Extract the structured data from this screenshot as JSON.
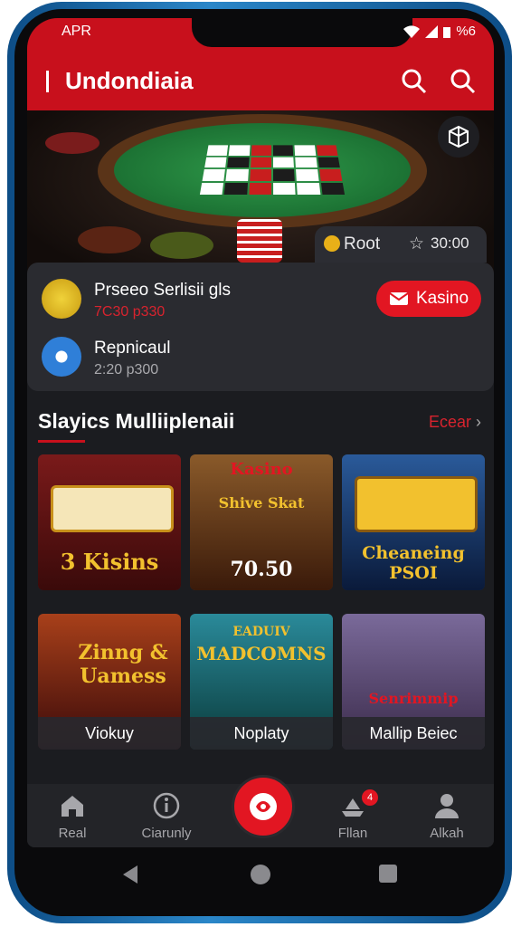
{
  "status": {
    "carrier": "APR",
    "battery": "%6"
  },
  "app": {
    "title": "Undondiaia"
  },
  "hero": {
    "tag_label": "Root",
    "tag_value": "30:00"
  },
  "players": [
    {
      "name": "Prseeo Serlisii gls",
      "sub": "7C30 p330"
    },
    {
      "name": "Repnicaul",
      "sub": "2:20 p300"
    }
  ],
  "kasino_button": "Kasino",
  "section": {
    "title": "Slayics Mulliiplenaii",
    "link": "Ecear"
  },
  "games": [
    {
      "name": "3 Kisins",
      "art_text": "3 Kisins",
      "color": "#7a1a1a"
    },
    {
      "name": "Kasino",
      "art_text": "Shive Skat",
      "art_value": "70.50",
      "color": "#5a3a1a"
    },
    {
      "name": "Cheaneing PSOI",
      "art_text": "Cheaneing PSOI",
      "color": "#2a4a7a"
    },
    {
      "name": "Viokuy",
      "art_text": "Zinng & Uamess",
      "color": "#8a2a10"
    },
    {
      "name": "Noplaty",
      "art_text": "MADCOMNS",
      "art_sub": "EADUIV",
      "color": "#1a6a7a"
    },
    {
      "name": "Mallip Beiec",
      "art_text": "Senrimmip",
      "color": "#6a4a7a"
    }
  ],
  "nav": {
    "items": [
      {
        "label": "Real",
        "icon": "home-icon"
      },
      {
        "label": "Ciarunly",
        "icon": "info-icon"
      },
      {
        "label": "Fllan",
        "icon": "ship-icon",
        "badge": "4"
      },
      {
        "label": "Alkah",
        "icon": "person-icon"
      }
    ]
  },
  "colors": {
    "accent": "#c8101c",
    "surface": "#1b1c20",
    "card": "#2a2b30"
  }
}
